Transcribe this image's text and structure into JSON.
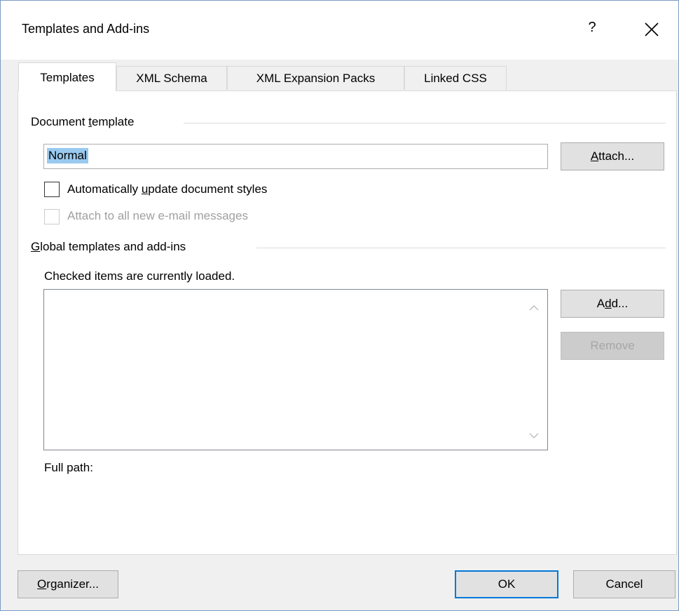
{
  "window": {
    "title": "Templates and Add-ins",
    "help": "?"
  },
  "tabs": [
    {
      "label": "Templates",
      "active": true
    },
    {
      "label": "XML Schema",
      "active": false
    },
    {
      "label": "XML Expansion Packs",
      "active": false
    },
    {
      "label": "Linked CSS",
      "active": false
    }
  ],
  "document_template": {
    "group_label_pre": "Document ",
    "group_label_key": "t",
    "group_label_post": "emplate",
    "template_value": "Normal",
    "attach_button_key": "A",
    "attach_button_post": "ttach...",
    "auto_update_pre": "Automatically ",
    "auto_update_key": "u",
    "auto_update_post": "pdate document styles",
    "auto_update_checked": false,
    "attach_email_label": "Attach to all new e-mail messages",
    "attach_email_checked": false
  },
  "global_templates": {
    "group_label_key": "G",
    "group_label_post": "lobal templates and add-ins",
    "hint": "Checked items are currently loaded.",
    "items": [],
    "add_button_pre": "A",
    "add_button_key": "d",
    "add_button_post": "d...",
    "remove_button": "Remove",
    "full_path_label": "Full path:"
  },
  "footer": {
    "organizer_key": "O",
    "organizer_post": "rganizer...",
    "ok_button": "OK",
    "cancel_button": "Cancel"
  },
  "icons": {
    "close": "close-icon",
    "scroll_up": "chevron-up-icon",
    "scroll_down": "chevron-down-icon"
  }
}
